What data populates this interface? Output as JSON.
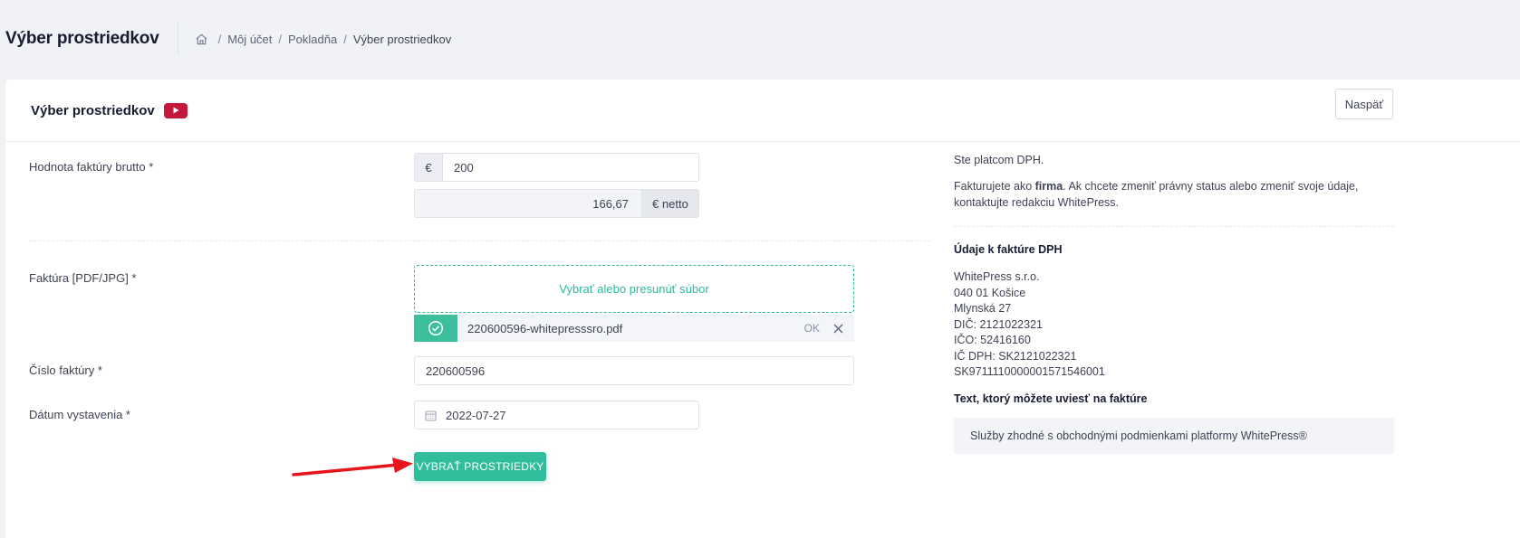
{
  "subheader": {
    "title": "Výber prostriedkov",
    "breadcrumb": [
      "Môj účet",
      "Pokladňa",
      "Výber prostriedkov"
    ]
  },
  "card": {
    "title": "Výber prostriedkov",
    "back_label": "Naspäť"
  },
  "form": {
    "gross_label": "Hodnota faktúry brutto  *",
    "currency_addon": "€",
    "gross_value": "200",
    "net_value": "166,67",
    "net_addon": "€ netto",
    "invoice_label": "Faktúra [PDF/JPG] *",
    "dropzone_text": "Vybrať alebo presunúť súbor",
    "file_name": "220600596-whitepresssro.pdf",
    "file_status": "OK",
    "number_label": "Číslo faktúry *",
    "number_value": "220600596",
    "date_label": "Dátum vystavenia *",
    "date_value": "2022-07-27",
    "submit_label": "VYBRAŤ PROSTRIEDKY"
  },
  "info": {
    "vat_payer": "Ste platcom DPH.",
    "invoicing_prefix": "Fakturujete ako ",
    "invoicing_bold": "firma",
    "invoicing_suffix": ". Ak chcete zmeniť právny status alebo zmeniť svoje údaje,",
    "invoicing_line2": "kontaktujte redakciu WhitePress.",
    "invoice_data_heading": "Údaje k faktúre DPH",
    "company_lines": [
      "WhitePress s.r.o.",
      "040 01 Košice",
      "Mlynská 27",
      "DIČ: 2121022321",
      "IČO: 52416160",
      "IČ DPH: SK2121022321",
      "SK9711110000001571546001"
    ],
    "text_heading": "Text, ktorý môžete uviesť na faktúre",
    "text_value": "Služby zhodné s obchodnými podmienkami platformy WhitePress®"
  },
  "colors": {
    "accent": "#2fbd9b",
    "youtube": "#c4183c",
    "arrow": "#e8141b"
  }
}
